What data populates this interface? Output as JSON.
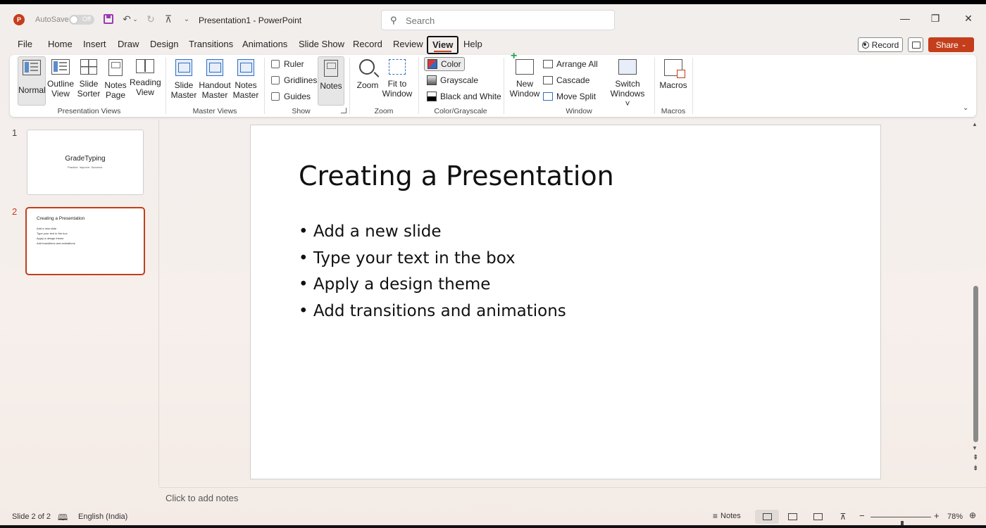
{
  "app": {
    "logo_letter": "P",
    "autosave_label": "AutoSave",
    "autosave_state": "Off",
    "title": "Presentation1  -  PowerPoint"
  },
  "search": {
    "placeholder": "Search"
  },
  "tabs": [
    "File",
    "Home",
    "Insert",
    "Draw",
    "Design",
    "Transitions",
    "Animations",
    "Slide Show",
    "Record",
    "Review",
    "View",
    "Help"
  ],
  "active_tab": "View",
  "header_actions": {
    "record_label": "Record",
    "share_label": "Share"
  },
  "ribbon": {
    "presentation_views": {
      "label": "Presentation Views",
      "normal": "Normal",
      "outline": [
        "Outline",
        "View"
      ],
      "sorter": [
        "Slide",
        "Sorter"
      ],
      "notes_page": [
        "Notes",
        "Page"
      ],
      "reading": [
        "Reading",
        "View"
      ]
    },
    "master_views": {
      "label": "Master Views",
      "slide": [
        "Slide",
        "Master"
      ],
      "handout": [
        "Handout",
        "Master"
      ],
      "notes": [
        "Notes",
        "Master"
      ]
    },
    "show": {
      "label": "Show",
      "ruler": "Ruler",
      "gridlines": "Gridlines",
      "guides": "Guides",
      "notes": "Notes"
    },
    "zoom": {
      "label": "Zoom",
      "zoom": "Zoom",
      "fit": [
        "Fit to",
        "Window"
      ]
    },
    "color_grayscale": {
      "label": "Color/Grayscale",
      "color": "Color",
      "grayscale": "Grayscale",
      "bw": "Black and White"
    },
    "window": {
      "label": "Window",
      "new": [
        "New",
        "Window"
      ],
      "arrange_all": "Arrange All",
      "cascade": "Cascade",
      "move_split": "Move Split",
      "switch": [
        "Switch",
        "Windows ˅"
      ]
    },
    "macros": {
      "label": "Macros",
      "macros": "Macros"
    }
  },
  "slides": [
    {
      "number": "1",
      "title": "GradeTyping",
      "subtitle": "Practice. Improve. Succeed."
    },
    {
      "number": "2",
      "title": "Creating a Presentation",
      "bullets": [
        "Add a new slide",
        "Type your text in the box",
        "Apply a design theme",
        "Add transitions and animations"
      ]
    }
  ],
  "current_slide": {
    "title": "Creating a Presentation",
    "bullets": [
      "Add a new slide",
      "Type your text in the box",
      "Apply a design theme",
      "Add transitions and animations"
    ]
  },
  "notes_placeholder": "Click to add notes",
  "status": {
    "slide_info": "Slide 2 of 2",
    "language": "English (India)",
    "notes_label": "Notes",
    "zoom_minus": "−",
    "zoom_plus": "+",
    "zoom_percent": "78%",
    "zoom_level": 0.52
  }
}
